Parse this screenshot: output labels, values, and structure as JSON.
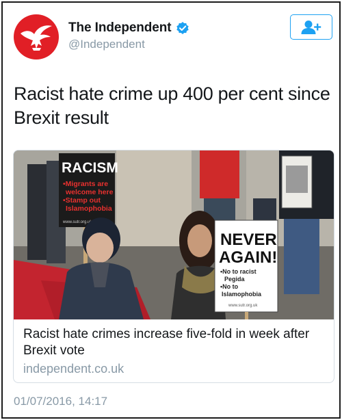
{
  "tweet": {
    "author": {
      "display_name": "The Independent",
      "handle": "@Independent",
      "avatar_icon": "eagle-logo-icon",
      "verified": true
    },
    "follow_button_icon": "add-user-icon",
    "text": "Racist hate crime up 400 per cent since Brexit result",
    "card": {
      "title": "Racist hate crimes increase five-fold in week after Brexit vote",
      "domain": "independent.co.uk",
      "image": {
        "sign_left": {
          "heading": "RACISM",
          "lines": [
            "•Migrants are",
            "welcome here",
            "•Stamp out",
            "Islamophobia"
          ],
          "footer": "www.sutr.org.uk"
        },
        "sign_right": {
          "heading_1": "NEVER",
          "heading_2": "AGAIN!",
          "lines": [
            "•No to racist",
            "Pegida",
            "•No to",
            "Islamophobia"
          ],
          "footer": "www.sutr.org.uk"
        }
      }
    },
    "timestamp": "01/07/2016, 14:17"
  },
  "colors": {
    "brand_red": "#e11f26",
    "twitter_blue": "#1da1f2",
    "muted_text": "#8899a6"
  }
}
